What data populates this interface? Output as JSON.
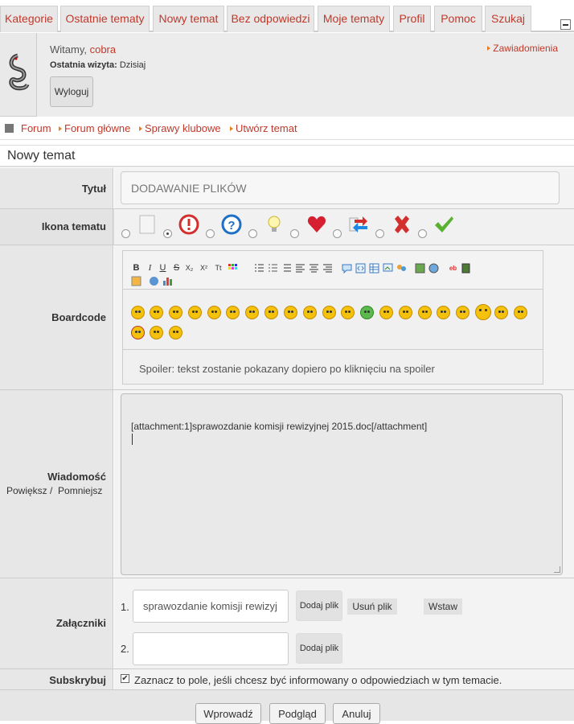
{
  "tabs": [
    "Kategorie",
    "Ostatnie tematy",
    "Nowy temat",
    "Bez odpowiedzi",
    "Moje tematy",
    "Profil",
    "Pomoc",
    "Szukaj"
  ],
  "user": {
    "welcome_prefix": "Witamy, ",
    "username": "cobra",
    "last_visit_label": "Ostatnia wizyta:",
    "last_visit_value": "Dzisiaj",
    "logout": "Wyloguj",
    "notifications": "Zawiadomienia"
  },
  "breadcrumb": [
    "Forum",
    "Forum główne",
    "Sprawy klubowe",
    "Utwórz temat"
  ],
  "page_title": "Nowy temat",
  "form": {
    "title_label": "Tytuł",
    "title_value": "DODAWANIE PLIKÓW",
    "icon_label": "Ikona tematu",
    "topic_icons": [
      "blank-page-icon",
      "exclamation-icon",
      "question-icon",
      "lightbulb-icon",
      "heart-icon",
      "arrows-swap-icon",
      "red-x-icon",
      "checkmark-icon"
    ],
    "boardcode_label": "Boardcode",
    "toolbar": {
      "bold": "B",
      "italic": "I",
      "underline": "U",
      "strike": "S",
      "sub": "X₂",
      "sup": "X²",
      "tt": "Tt"
    },
    "spoiler_hint": "Spoiler: tekst zostanie pokazany dopiero po kliknięciu na spoiler",
    "message_label": "Wiadomość",
    "zoom_in": "Powiększ /",
    "zoom_out": "Pomniejsz",
    "message_value": "[attachment:1]sprawozdanie komisji rewizyjnej 2015.doc[/attachment]",
    "attachments_label": "Załączniki",
    "att1_num": "1.",
    "att1_value": "sprawozdanie komisji rewizyj",
    "att2_num": "2.",
    "att2_value": "",
    "add_file": "Dodaj plik",
    "remove_file": "Usuń plik",
    "insert": "Wstaw",
    "subscribe_label": "Subskrybuj",
    "subscribe_checked": "✔",
    "subscribe_text": "Zaznacz to pole, jeśli chcesz być informowany o odpowiedziach w tym temacie.",
    "submit": "Wprowadź",
    "preview": "Podgląd",
    "cancel": "Anuluj"
  },
  "colors": {
    "link": "#c0392b",
    "arrow": "#e67e22"
  }
}
